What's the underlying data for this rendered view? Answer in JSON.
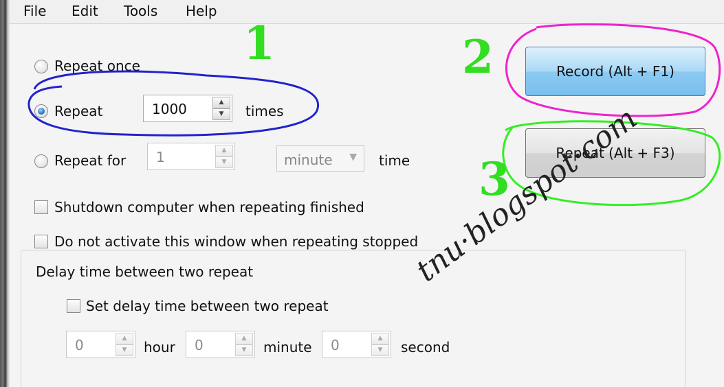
{
  "menu": {
    "file": "File",
    "edit": "Edit",
    "tools": "Tools",
    "help": "Help"
  },
  "repeat_options": {
    "once_label": "Repeat once",
    "repeat_label": "Repeat",
    "repeat_count": "1000",
    "times_label": "times",
    "for_label": "Repeat for",
    "for_value": "1",
    "for_unit": "minute",
    "time_label": "time",
    "selected": "repeat"
  },
  "checkboxes": {
    "shutdown": "Shutdown computer when repeating finished",
    "no_activate": "Do not activate this window when repeating stopped"
  },
  "delay_group": {
    "title": "Delay time between two repeat",
    "set_delay": "Set delay time between two repeat",
    "hour_value": "0",
    "hour_label": "hour",
    "minute_value": "0",
    "minute_label": "minute",
    "second_value": "0",
    "second_label": "second"
  },
  "buttons": {
    "record": "Record (Alt + F1)",
    "repeat": "Repeat (Alt + F3)"
  },
  "annotations": {
    "one": "1",
    "two": "2",
    "three": "3",
    "watermark": "tnu·blogspot·com"
  },
  "colors": {
    "annotation_green": "#33dd22",
    "circle_blue": "#2222cc",
    "circle_magenta": "#ee22cc",
    "circle_green": "#33ee22"
  }
}
